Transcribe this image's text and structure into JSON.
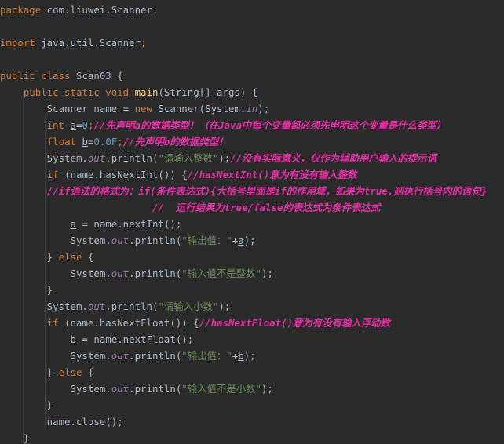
{
  "editor": {
    "lines": [
      [
        {
          "t": "package",
          "c": "kw"
        },
        {
          "t": " com.liuwei.Scanner",
          "c": "plain"
        },
        {
          "t": ";",
          "c": "kw"
        }
      ],
      [],
      [
        {
          "t": "import",
          "c": "kw"
        },
        {
          "t": " java.util.Scanner",
          "c": "plain"
        },
        {
          "t": ";",
          "c": "kw"
        }
      ],
      [],
      [
        {
          "t": "public class",
          "c": "kw"
        },
        {
          "t": " Scan03 {",
          "c": "plain"
        }
      ],
      [
        {
          "t": "    "
        },
        {
          "t": "public static void",
          "c": "kw"
        },
        {
          "t": " "
        },
        {
          "t": "main",
          "c": "fn"
        },
        {
          "t": "(String[] args) {",
          "c": "plain"
        }
      ],
      [
        {
          "t": "        Scanner name = ",
          "c": "plain"
        },
        {
          "t": "new",
          "c": "kw"
        },
        {
          "t": " Scanner(System.",
          "c": "plain"
        },
        {
          "t": "in",
          "c": "static-field"
        },
        {
          "t": ");",
          "c": "plain"
        }
      ],
      [
        {
          "t": "        "
        },
        {
          "t": "int",
          "c": "kw"
        },
        {
          "t": " "
        },
        {
          "t": "a",
          "c": "var-under"
        },
        {
          "t": "="
        },
        {
          "t": "0",
          "c": "num"
        },
        {
          "t": ";",
          "c": "kw"
        },
        {
          "t": "//先声明a的数据类型！（在Java中每个变量都必须先申明这个变量是什么类型）",
          "c": "cmt"
        }
      ],
      [
        {
          "t": "        "
        },
        {
          "t": "float",
          "c": "kw"
        },
        {
          "t": " "
        },
        {
          "t": "b",
          "c": "var-under"
        },
        {
          "t": "="
        },
        {
          "t": "0.0F",
          "c": "num"
        },
        {
          "t": ";",
          "c": "kw"
        },
        {
          "t": "//先声明b的数据类型！",
          "c": "cmt"
        }
      ],
      [
        {
          "t": "        System."
        },
        {
          "t": "out",
          "c": "static-field"
        },
        {
          "t": ".println("
        },
        {
          "t": "\"请输入整数\"",
          "c": "str"
        },
        {
          "t": ");"
        },
        {
          "t": "//没有实际意义，仅作为辅助用户输入的提示语",
          "c": "cmt"
        }
      ],
      [
        {
          "t": "        "
        },
        {
          "t": "if",
          "c": "kw"
        },
        {
          "t": " (name.hasNextInt()) {"
        },
        {
          "t": "//hasNextInt()意为有没有输入整数",
          "c": "cmt"
        }
      ],
      [
        {
          "t": "        "
        },
        {
          "t": "//if语法的格式为：if(条件表达式){大括号里面是if的作用域，如果为true,则执行括号内的语句}",
          "c": "cmt"
        }
      ],
      [
        {
          "t": "                          "
        },
        {
          "t": "//  运行结果为true/false的表达式为条件表达式",
          "c": "cmt"
        }
      ],
      [
        {
          "t": "            "
        },
        {
          "t": "a",
          "c": "var-under"
        },
        {
          "t": " = name.nextInt();"
        }
      ],
      [
        {
          "t": "            System."
        },
        {
          "t": "out",
          "c": "static-field"
        },
        {
          "t": ".println("
        },
        {
          "t": "\"输出值：\"",
          "c": "str"
        },
        {
          "t": "+"
        },
        {
          "t": "a",
          "c": "var-under"
        },
        {
          "t": ");"
        }
      ],
      [
        {
          "t": "        } "
        },
        {
          "t": "else",
          "c": "kw"
        },
        {
          "t": " {"
        }
      ],
      [
        {
          "t": "            System."
        },
        {
          "t": "out",
          "c": "static-field"
        },
        {
          "t": ".println("
        },
        {
          "t": "\"输入值不是整数\"",
          "c": "str"
        },
        {
          "t": ");"
        }
      ],
      [
        {
          "t": "        }"
        }
      ],
      [
        {
          "t": "        System."
        },
        {
          "t": "out",
          "c": "static-field"
        },
        {
          "t": ".println("
        },
        {
          "t": "\"请输入小数\"",
          "c": "str"
        },
        {
          "t": ");"
        }
      ],
      [
        {
          "t": "        "
        },
        {
          "t": "if",
          "c": "kw"
        },
        {
          "t": " (name.hasNextFloat()) {"
        },
        {
          "t": "//hasNextFloat()意为有没有输入浮动数",
          "c": "cmt"
        }
      ],
      [
        {
          "t": "            "
        },
        {
          "t": "b",
          "c": "var-under"
        },
        {
          "t": " = name.nextFloat();"
        }
      ],
      [
        {
          "t": "            System."
        },
        {
          "t": "out",
          "c": "static-field"
        },
        {
          "t": ".println("
        },
        {
          "t": "\"输出值：\"",
          "c": "str"
        },
        {
          "t": "+"
        },
        {
          "t": "b",
          "c": "var-under"
        },
        {
          "t": ");"
        }
      ],
      [
        {
          "t": "        } "
        },
        {
          "t": "else",
          "c": "kw"
        },
        {
          "t": " {"
        }
      ],
      [
        {
          "t": "            System."
        },
        {
          "t": "out",
          "c": "static-field"
        },
        {
          "t": ".println("
        },
        {
          "t": "\"输入值不是小数\"",
          "c": "str"
        },
        {
          "t": ");"
        }
      ],
      [
        {
          "t": "        }"
        }
      ],
      [
        {
          "t": "        name.close();"
        }
      ],
      [
        {
          "t": "    }"
        }
      ]
    ]
  },
  "colors": {
    "background": "#2b2b2b",
    "keyword": "#cc7832",
    "string": "#6a8759",
    "number": "#6897bb",
    "method": "#ffc66d",
    "static_field": "#9876aa",
    "comment": "#e32ea4",
    "text": "#a9b7c6"
  }
}
